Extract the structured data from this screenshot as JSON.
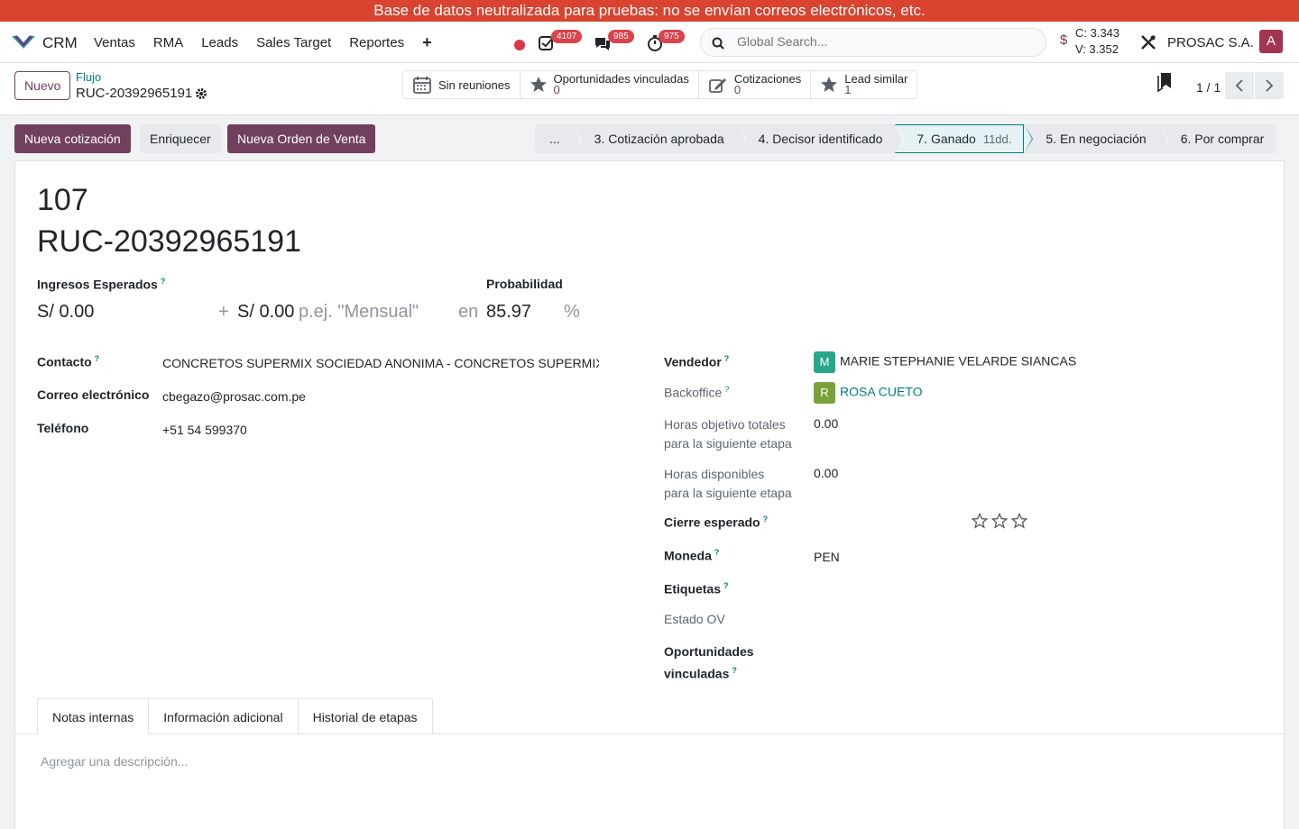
{
  "banner": "Base de datos neutralizada para pruebas: no se envían correos electrónicos, etc.",
  "navbar": {
    "app_name": "CRM",
    "menu": [
      "Ventas",
      "RMA",
      "Leads",
      "Sales Target",
      "Reportes"
    ],
    "plus": "+",
    "badges": {
      "activities": "4107",
      "messages": "985",
      "timers": "975"
    },
    "search_placeholder": "Global Search...",
    "rates": {
      "currency_symbol": "$",
      "buy": "C: 3.343",
      "sell": "V: 3.352"
    },
    "company": "PROSAC S.A.",
    "user_initial": "A"
  },
  "control": {
    "new_label": "Nuevo",
    "breadcrumb_parent": "Flujo",
    "breadcrumb_current": "RUC-20392965191",
    "smart_buttons": [
      {
        "label": "Sin reuniones",
        "icon": "calendar-icon"
      },
      {
        "label": "Oportunidades vinculadas",
        "count": "0",
        "icon": "star-icon"
      },
      {
        "label": "Cotizaciones",
        "count": "0",
        "icon": "pencil-square-icon"
      },
      {
        "label": "Lead similar",
        "count": "1",
        "icon": "star-icon"
      }
    ],
    "pager": "1 / 1"
  },
  "actions": {
    "new_quote": "Nueva cotización",
    "enrich": "Enriquecer",
    "new_sale_order": "Nueva Orden de Venta"
  },
  "stages": [
    {
      "label": "..."
    },
    {
      "label": "3. Cotización aprobada"
    },
    {
      "label": "4. Decisor identificado"
    },
    {
      "label": "7. Ganado",
      "duration": "11dd.",
      "active": true
    },
    {
      "label": "5. En negociación"
    },
    {
      "label": "6. Por comprar"
    }
  ],
  "form": {
    "number": "107",
    "name": "RUC-20392965191",
    "expected_revenue_label": "Ingresos Esperados",
    "expected_revenue": "S/ 0.00",
    "plus_sign": "+",
    "recurring_revenue": "S/ 0.00",
    "recurring_placeholder": "p.ej. \"Mensual\"",
    "probability_label": "Probabilidad",
    "in_word": "en",
    "probability": "85.97",
    "percent": "%",
    "contact_label": "Contacto",
    "contact": "CONCRETOS SUPERMIX SOCIEDAD ANONIMA - CONCRETOS SUPERMIX S",
    "email_label": "Correo electrónico",
    "email": "cbegazo@prosac.com.pe",
    "phone_label": "Teléfono",
    "phone": "+51 54 599370",
    "salesperson_label": "Vendedor",
    "salesperson_initial": "M",
    "salesperson": "MARIE STEPHANIE VELARDE SIANCAS",
    "backoffice_label": "Backoffice",
    "backoffice_initial": "R",
    "backoffice": "ROSA CUETO",
    "target_hours_label_1": "Horas objetivo totales",
    "target_hours_label_2": "para la siguiente etapa",
    "target_hours": "0.00",
    "available_hours_label_1": "Horas disponibles",
    "available_hours_label_2": "para la siguiente etapa",
    "available_hours": "0.00",
    "expected_close_label": "Cierre esperado",
    "currency_label": "Moneda",
    "currency": "PEN",
    "tags_label": "Etiquetas",
    "so_state_label": "Estado OV",
    "linked_opps_label_1": "Oportunidades",
    "linked_opps_label_2": "vinculadas",
    "help_mark": "?"
  },
  "tabs": [
    "Notas internas",
    "Información adicional",
    "Historial de etapas"
  ],
  "description_placeholder": "Agregar una descripción...",
  "colors": {
    "brand": "#71405e",
    "teal": "#017e84",
    "banner": "#d9432f",
    "badge": "#d9434b",
    "avatar_m": "#28a78b",
    "avatar_r": "#7aa03a"
  }
}
